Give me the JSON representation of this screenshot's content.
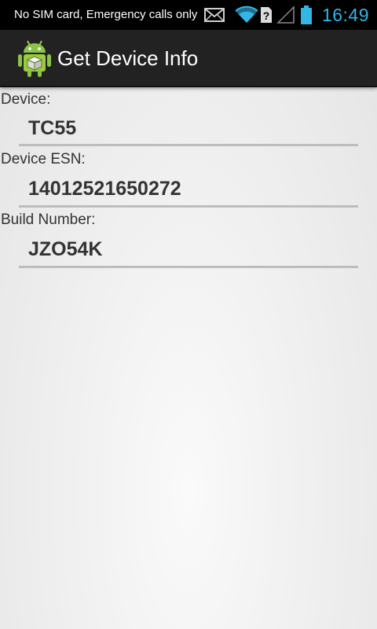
{
  "status_bar": {
    "carrier_text": "No SIM card, Emergency calls only",
    "time": "16:49",
    "icons": [
      "gmail-icon",
      "wifi-icon",
      "no-sim-icon",
      "signal-icon",
      "battery-icon"
    ],
    "accent_color": "#33b5e5"
  },
  "action_bar": {
    "title": "Get Device Info",
    "icon": "android-app-icon"
  },
  "fields": [
    {
      "label": "Device:",
      "value": "TC55"
    },
    {
      "label": "Device ESN:",
      "value": "14012521650272"
    },
    {
      "label": "Build Number:",
      "value": "JZO54K"
    }
  ]
}
